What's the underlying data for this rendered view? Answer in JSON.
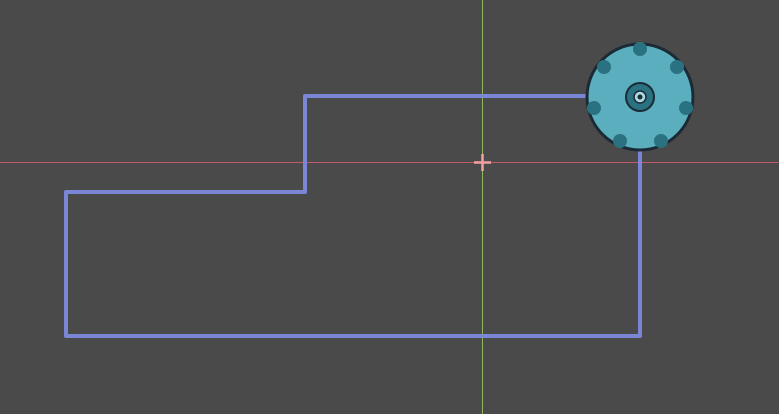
{
  "editor": {
    "canvas_background": "#4a4a4a",
    "axes": {
      "x_axis_color": "#c15b6b",
      "y_axis_color": "#8fb860"
    },
    "origin_marker": {
      "icon": "crosshair-icon",
      "color": "#f4a0a0"
    },
    "path": {
      "icon": "path-outline",
      "color": "#7b86d6"
    },
    "node": {
      "icon": "saw-gear-icon",
      "fill": "#5aaebd",
      "dark": "#2a7281",
      "outline": "#1b2a35",
      "center": "#a9d9df"
    }
  }
}
